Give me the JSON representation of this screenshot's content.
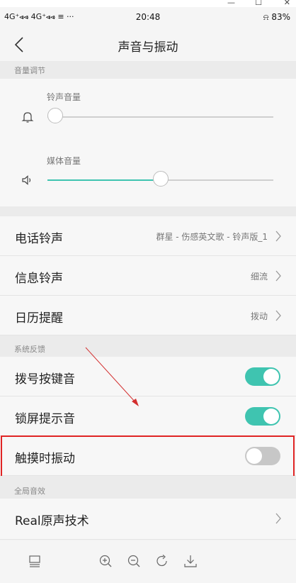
{
  "status_bar": {
    "left": "4G⁺⩹⩹ 4G⁺⩹⩹ ≡ ···",
    "time": "20:48",
    "right": "⍾ 83%"
  },
  "header": {
    "title": "声音与振动"
  },
  "volume": {
    "section_label": "音量调节",
    "ringtone_label": "铃声音量",
    "ringtone_level": 0,
    "media_label": "媒体音量",
    "media_level": 0.5
  },
  "ringtones": [
    {
      "label": "电话铃声",
      "value": "群星 - 伤感英文歌 - 铃声版_1"
    },
    {
      "label": "信息铃声",
      "value": "细流"
    },
    {
      "label": "日历提醒",
      "value": "拨动"
    }
  ],
  "feedback": {
    "section_label": "系统反馈",
    "items": [
      {
        "label": "拨号按键音",
        "on": true
      },
      {
        "label": "锁屏提示音",
        "on": true
      },
      {
        "label": "触摸时振动",
        "on": false
      }
    ]
  },
  "global": {
    "section_label": "全局音效",
    "items": [
      {
        "label": "Real原声技术"
      }
    ]
  },
  "colors": {
    "accent": "#3fc4b0",
    "toggle_off": "#c7c7c7",
    "highlight": "#e02424",
    "annotation_arrow": "#d32f2f"
  },
  "bottom_toolbar": [
    "layout-icon",
    "zoom-in-icon",
    "zoom-out-icon",
    "rotate-icon",
    "download-icon"
  ]
}
